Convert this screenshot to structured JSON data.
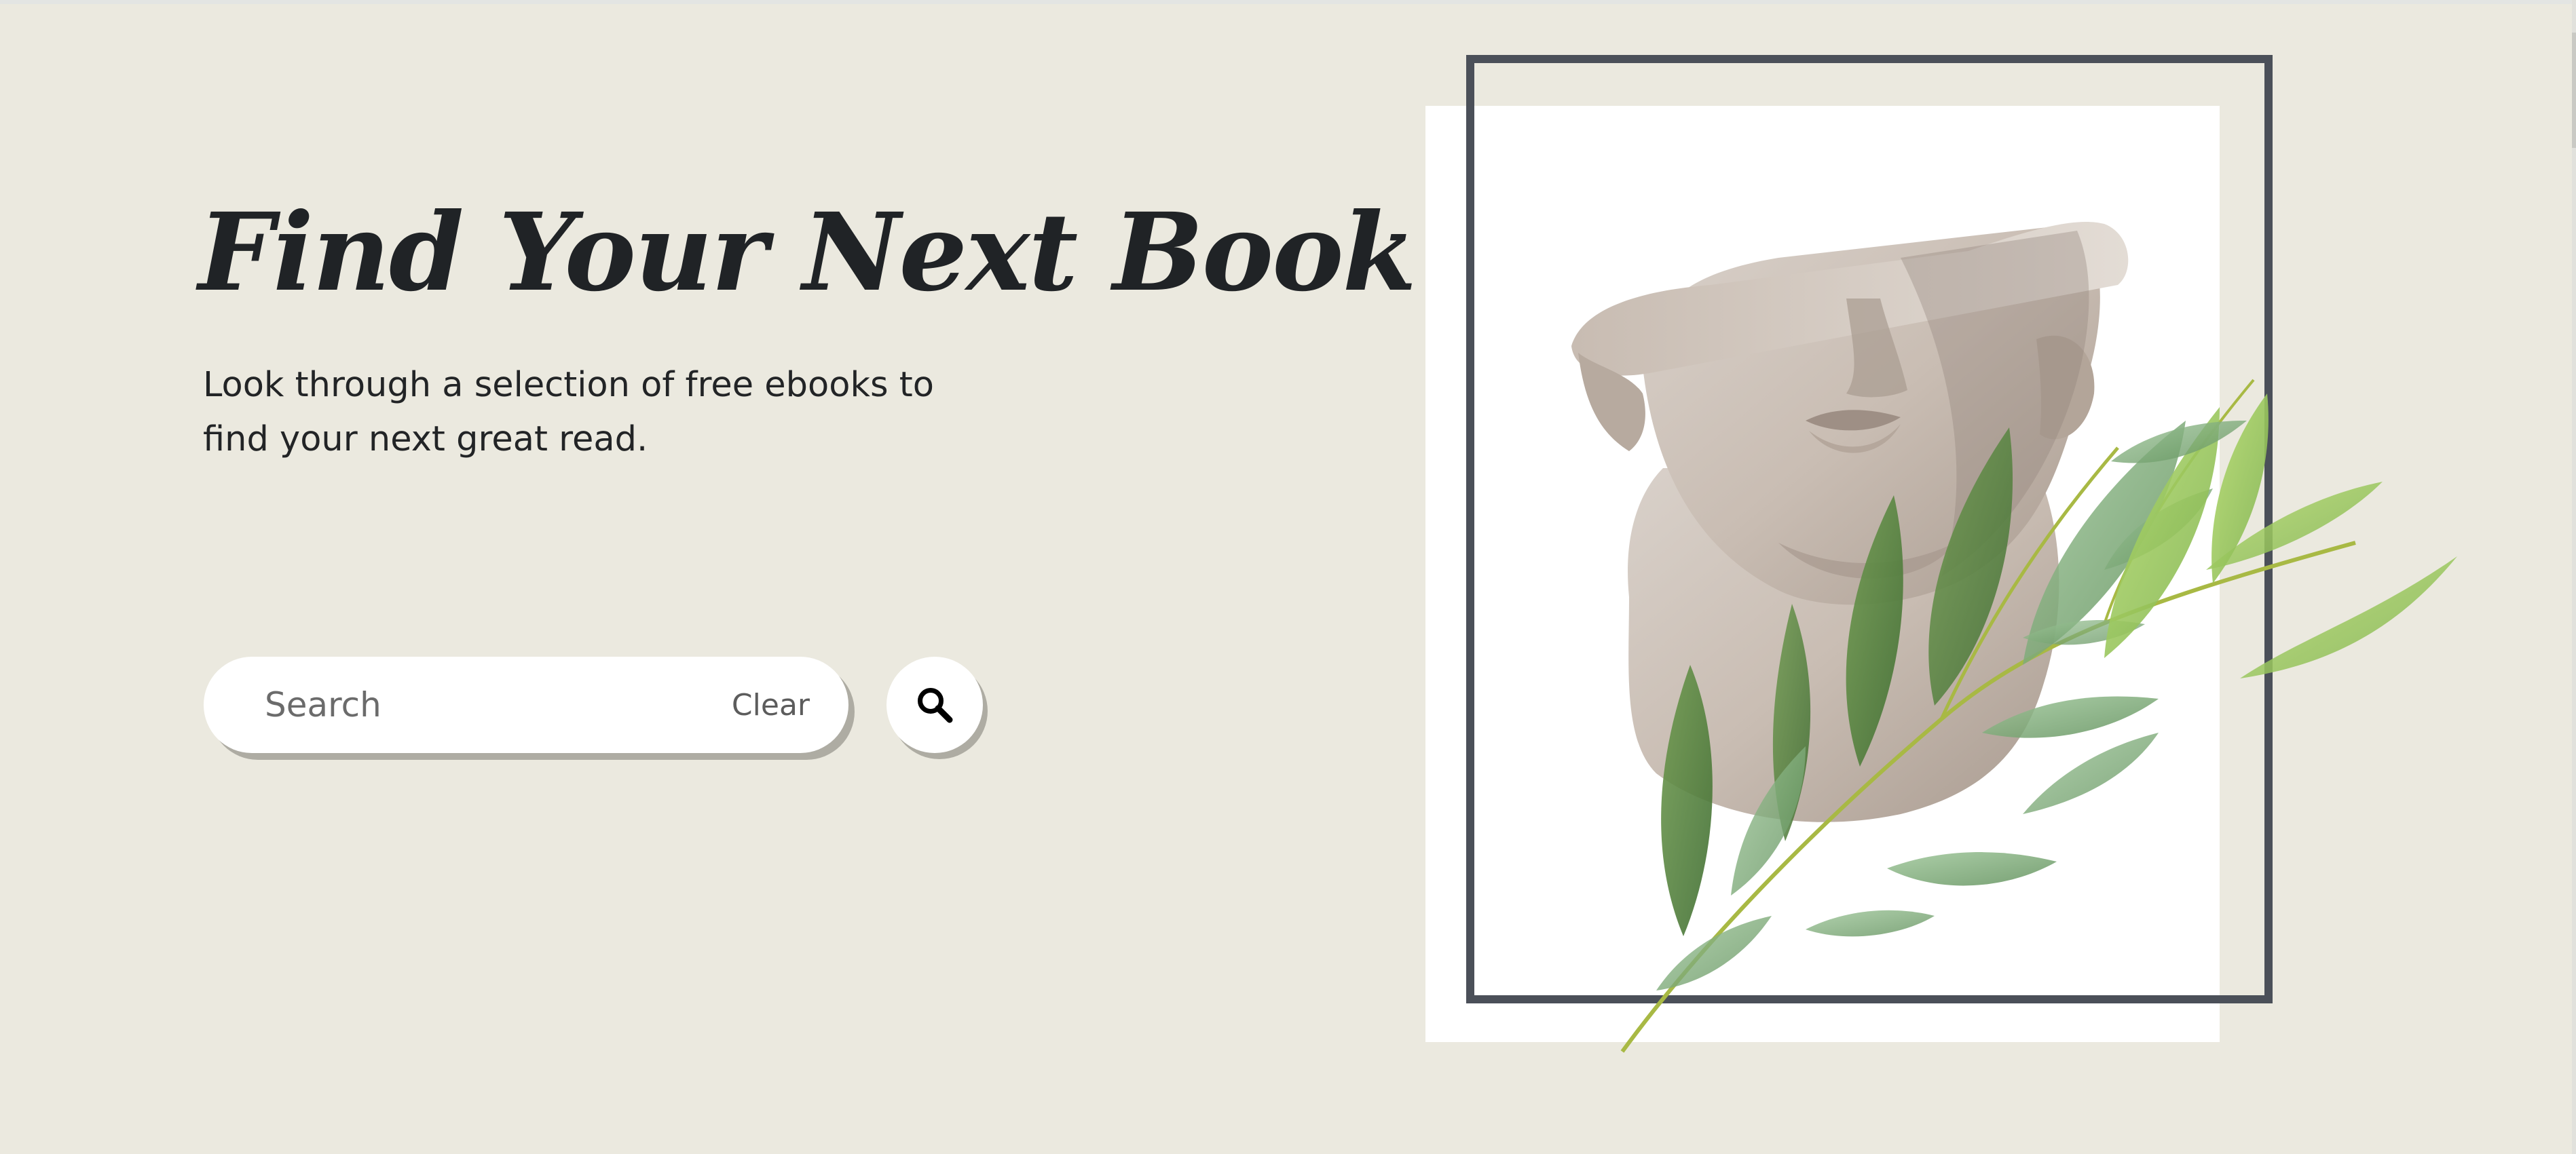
{
  "hero": {
    "title": "Find Your Next Book",
    "subtitle": "Look through a selection of free ebooks to find your next great read."
  },
  "search": {
    "placeholder": "Search",
    "value": "",
    "clear_label": "Clear",
    "button_icon": "search-icon"
  },
  "illustration": {
    "subject": "statue-head-with-eucalyptus"
  },
  "colors": {
    "background": "#ebe9df",
    "text": "#202326",
    "frame": "#4b5059",
    "shadow": "#aeaca3"
  }
}
